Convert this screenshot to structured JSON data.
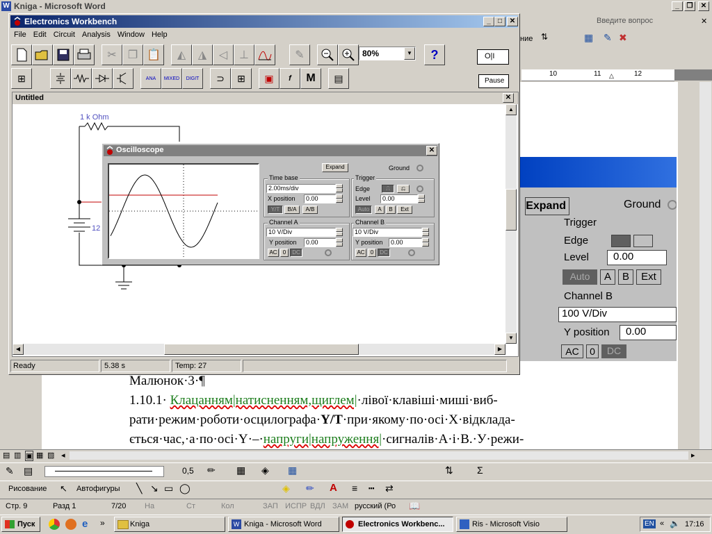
{
  "word": {
    "title": "Kniga - Microsoft Word",
    "ask_placeholder": "Введите вопрос",
    "menu_partial": "ние",
    "ruler_marks": [
      "10",
      "11",
      "12"
    ],
    "bg_expand": "Expand",
    "bg_ground": "Ground",
    "bg_trigger": "Trigger",
    "bg_edge": "Edge",
    "bg_level": "Level",
    "bg_level_val": "0.00",
    "bg_auto": "Auto",
    "bg_a": "A",
    "bg_b": "B",
    "bg_ext": "Ext",
    "bg_channel_b": "Channel B",
    "bg_v_div": "100  V/Div",
    "bg_ypos": "Y position",
    "bg_ypos_val": "0.00",
    "bg_ac": "AC",
    "bg_zero": "0",
    "bg_dc": "DC",
    "doc_caption": "Малюнок·3·¶",
    "doc_line1_prefix": "1.10.1·",
    "doc_line1_green": "Клацанням|натисненням,щиглем|",
    "doc_line1_suffix": "·лівої·клавіші·миші·виб-",
    "doc_line2": "рати·режим·роботи·осцилографа·",
    "doc_line2_bold": "Y/T",
    "doc_line2_rest": "·при·якому·по·осі·X·відкладa-",
    "doc_line3_prefix": "ється·час,·а·по·осі·Y·–·",
    "doc_line3_green": "напруги|напруження|",
    "doc_line3_suffix": "·сигналів·А·і·В.·У·режи-",
    "line_width": "0,5",
    "drawing_label": "Рисование",
    "autoshapes_label": "Автофигуры",
    "status": {
      "page": "Стр.  9",
      "section": "Разд  1",
      "pages": "7/20",
      "at": "На",
      "line": "Ст",
      "col": "Кол",
      "rec": "ЗАП",
      "trk": "ИСПР",
      "ext": "ВДЛ",
      "ovr": "ЗАМ",
      "lang": "русский (Ро"
    }
  },
  "ewb": {
    "title": "Electronics Workbench",
    "menu": [
      "File",
      "Edit",
      "Circuit",
      "Analysis",
      "Window",
      "Help"
    ],
    "zoom": "80%",
    "help_glyph": "?",
    "switch_label": "O|I",
    "pause_label": "Pause",
    "doc_title": "Untitled",
    "resistor_label": "1 k Ohm",
    "battery_label": "12",
    "status_ready": "Ready",
    "status_time": "5.38 s",
    "status_temp": "Temp:  27"
  },
  "osc": {
    "title": "Oscilloscope",
    "expand": "Expand",
    "ground": "Ground",
    "timebase_title": "Time base",
    "timebase_value": "2.00ms/div",
    "xpos_label": "X position",
    "xpos_value": "0.00",
    "mode_yt": "Y/T",
    "mode_ba": "B/A",
    "mode_ab": "A/B",
    "trigger_title": "Trigger",
    "edge_label": "Edge",
    "level_label": "Level",
    "level_value": "0.00",
    "auto": "Auto",
    "a": "A",
    "b": "B",
    "ext": "Ext",
    "chA_title": "Channel A",
    "chA_vdiv": "10  V/Div",
    "chA_ypos_label": "Y position",
    "chA_ypos_value": "0.00",
    "chB_title": "Channel B",
    "chB_vdiv": "10  V/Div",
    "chB_ypos_label": "Y position",
    "chB_ypos_value": "0.00",
    "ac": "AC",
    "zero": "0",
    "dc": "DC"
  },
  "taskbar": {
    "start": "Пуск",
    "buttons": [
      "Kniga",
      "Kniga - Microsoft Word",
      "Electronics Workbenc...",
      "Ris - Microsoft Visio"
    ],
    "lang": "EN",
    "clock": "17:16"
  },
  "colors": {
    "title_active": "#0a246a",
    "title_active_end": "#a6caf0",
    "ewb_blue": "#0000c0",
    "trace_red": "#c00000",
    "green_text": "#1c7d1c"
  }
}
